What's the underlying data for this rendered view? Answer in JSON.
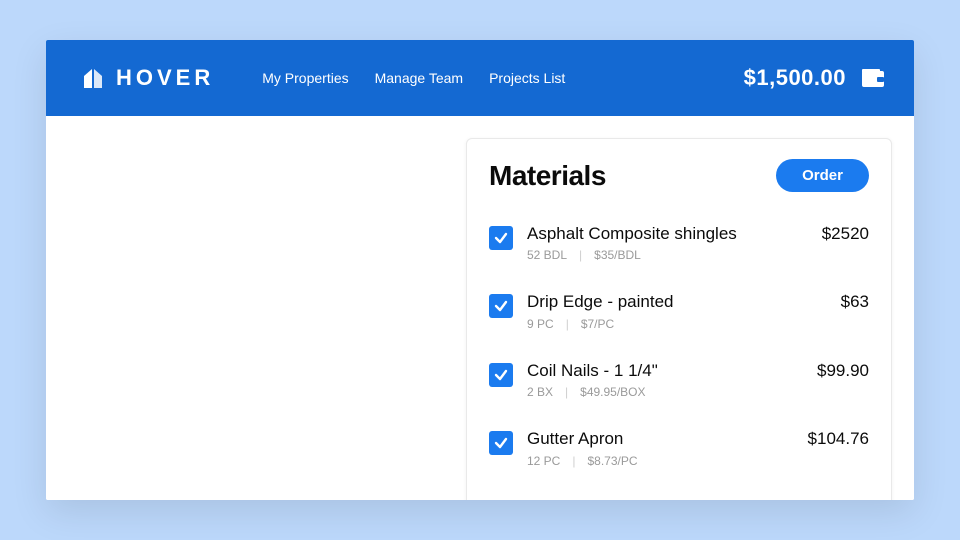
{
  "header": {
    "brand_text": "HOVER",
    "nav_items": [
      "My Properties",
      "Manage Team",
      "Projects List"
    ],
    "balance": "$1,500.00"
  },
  "card": {
    "title": "Materials",
    "order_label": "Order",
    "items": [
      {
        "name": "Asphalt Composite shingles",
        "qty": "52 BDL",
        "unit_price": "$35/BDL",
        "total": "$2520"
      },
      {
        "name": "Drip Edge - painted",
        "qty": "9 PC",
        "unit_price": "$7/PC",
        "total": "$63"
      },
      {
        "name": "Coil Nails - 1 1/4\"",
        "qty": "2 BX",
        "unit_price": "$49.95/BOX",
        "total": "$99.90"
      },
      {
        "name": "Gutter Apron",
        "qty": "12 PC",
        "unit_price": "$8.73/PC",
        "total": "$104.76"
      }
    ]
  },
  "colors": {
    "primary": "#1b7bef",
    "header": "#1469d2"
  }
}
